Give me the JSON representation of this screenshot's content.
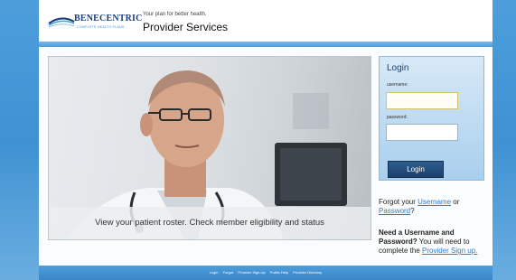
{
  "header": {
    "brand": "BENECENTRIC",
    "brand_sub": "COMPLETE HEALTH PLANS",
    "tagline": "Your plan for better health.",
    "title": "Provider Services"
  },
  "hero": {
    "caption": "View your patient roster. Check member eligibility and status"
  },
  "login": {
    "title": "Login",
    "username_label": "username:",
    "password_label": "password:",
    "button": "Login"
  },
  "forgot": {
    "prefix": "Forgot your ",
    "username_link": "Username",
    "or": " or",
    "password_link": "Password",
    "suffix": "?"
  },
  "need": {
    "bold": "Need a Username and Password?",
    "text": " You will need to complete the ",
    "link": "Provider Sign up."
  },
  "footer": {
    "links": [
      "Login",
      "Forgot",
      "Provider Sign-Up",
      "Public Help",
      "Provider Directory"
    ]
  },
  "colors": {
    "accent": "#4d9edb",
    "brand": "#1a3f7a",
    "link": "#2f7fc9"
  }
}
